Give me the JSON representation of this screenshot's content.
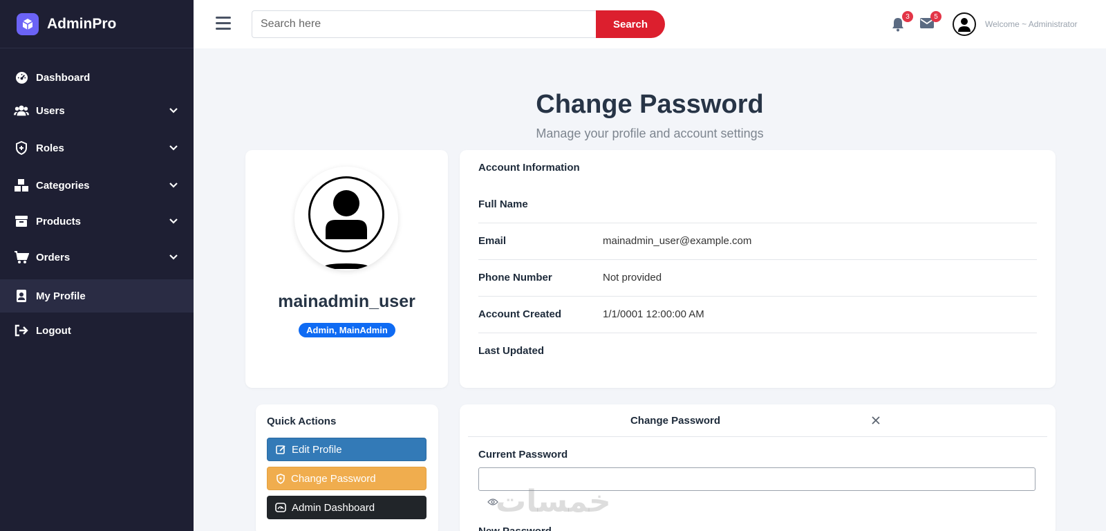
{
  "brand": {
    "name": "AdminPro"
  },
  "sidebar": {
    "items": [
      {
        "label": "Dashboard",
        "icon": "dashboard-icon"
      },
      {
        "label": "Users",
        "icon": "users-icon",
        "has_children": true
      },
      {
        "label": "Roles",
        "icon": "shield-icon",
        "has_children": true
      },
      {
        "label": "Categories",
        "icon": "boxes-icon",
        "has_children": true
      },
      {
        "label": "Products",
        "icon": "box-icon",
        "has_children": true
      },
      {
        "label": "Orders",
        "icon": "cart-icon",
        "has_children": true
      },
      {
        "label": "My Profile",
        "icon": "id-badge-icon",
        "active": true
      },
      {
        "label": "Logout",
        "icon": "logout-icon"
      }
    ]
  },
  "topbar": {
    "search_placeholder": "Search here",
    "search_button": "Search",
    "notifications_count": "3",
    "messages_count": "5",
    "welcome": "Welcome ~ Administrator"
  },
  "header": {
    "title": "Change Password",
    "subtitle": "Manage your profile and account settings"
  },
  "profile": {
    "username": "mainadmin_user",
    "roles": "Admin, MainAdmin"
  },
  "account": {
    "title": "Account Information",
    "rows": [
      {
        "label": "Full Name",
        "value": ""
      },
      {
        "label": "Email",
        "value": "mainadmin_user@example.com"
      },
      {
        "label": "Phone Number",
        "value": "Not provided"
      },
      {
        "label": "Account Created",
        "value": "1/1/0001 12:00:00 AM"
      },
      {
        "label": "Last Updated",
        "value": ""
      }
    ]
  },
  "quick_actions": {
    "title": "Quick Actions",
    "edit_profile": "Edit Profile",
    "change_password": "Change Password",
    "admin_dashboard": "Admin Dashboard"
  },
  "change_password": {
    "title": "Change Password",
    "current_label": "Current Password",
    "new_label": "New Password"
  },
  "watermark": "خمسات",
  "colors": {
    "sidebar_bg": "#1e1f33",
    "brand_accent": "#6b63f6",
    "search_button": "#dc1f2e",
    "edit_button": "#337ab7",
    "password_button": "#f0ad4e",
    "dashboard_button": "#212529",
    "role_badge": "#0f6bf3"
  }
}
